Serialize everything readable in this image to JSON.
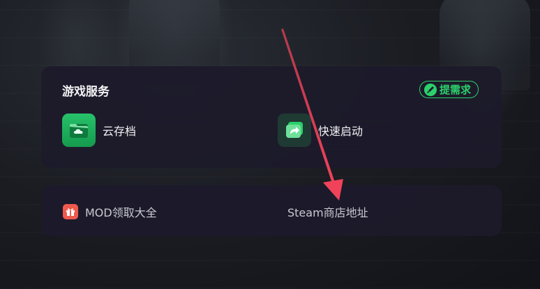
{
  "services_panel": {
    "title": "游戏服务",
    "request_button_label": "提需求",
    "items": [
      {
        "label": "云存档",
        "icon": "cloud-save-icon"
      },
      {
        "label": "快速启动",
        "icon": "quick-launch-icon"
      }
    ]
  },
  "links_panel": {
    "items": [
      {
        "label": "MOD领取大全",
        "icon": "gift-icon"
      },
      {
        "label": "Steam商店地址"
      }
    ]
  },
  "colors": {
    "accent_green": "#2bd16b",
    "annotation_arrow": "#f0435a",
    "panel_bg": "#1d1b2a"
  }
}
